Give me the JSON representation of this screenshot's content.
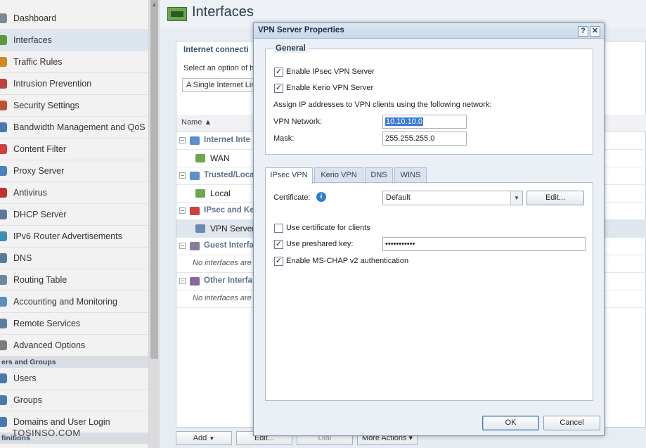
{
  "sidebar": {
    "items": [
      {
        "label": "Dashboard",
        "icon": "dashboard-icon",
        "color": "#7a8a9a"
      },
      {
        "label": "Interfaces",
        "icon": "interfaces-icon",
        "color": "#5a9a3a"
      },
      {
        "label": "Traffic Rules",
        "icon": "traffic-rules-icon",
        "color": "#d08a20"
      },
      {
        "label": "Intrusion Prevention",
        "icon": "intrusion-prevention-icon",
        "color": "#c04040"
      },
      {
        "label": "Security Settings",
        "icon": "security-settings-icon",
        "color": "#c05030"
      },
      {
        "label": "Bandwidth Management and QoS",
        "icon": "bandwidth-icon",
        "color": "#4a7ab0"
      },
      {
        "label": "Content Filter",
        "icon": "content-filter-icon",
        "color": "#d04040"
      },
      {
        "label": "Proxy Server",
        "icon": "proxy-server-icon",
        "color": "#4a80c0"
      },
      {
        "label": "Antivirus",
        "icon": "antivirus-icon",
        "color": "#c03030"
      },
      {
        "label": "DHCP Server",
        "icon": "dhcp-server-icon",
        "color": "#5a7a9a"
      },
      {
        "label": "IPv6 Router Advertisements",
        "icon": "ipv6-icon",
        "color": "#3a90b0"
      },
      {
        "label": "DNS",
        "icon": "dns-icon",
        "color": "#5a7a9a"
      },
      {
        "label": "Routing Table",
        "icon": "routing-table-icon",
        "color": "#6a8aa0"
      },
      {
        "label": "Accounting and Monitoring",
        "icon": "accounting-icon",
        "color": "#5a90c0"
      },
      {
        "label": "Remote Services",
        "icon": "remote-services-icon",
        "color": "#5a80a0"
      },
      {
        "label": "Advanced Options",
        "icon": "advanced-options-icon",
        "color": "#7a7a7a"
      }
    ],
    "section_users": "ers and Groups",
    "user_items": [
      {
        "label": "Users",
        "icon": "users-icon",
        "color": "#4a78b0"
      },
      {
        "label": "Groups",
        "icon": "groups-icon",
        "color": "#4a78b0"
      },
      {
        "label": "Domains and User Login",
        "icon": "domains-icon",
        "color": "#4a78b0"
      }
    ],
    "section_definitions": "finitions"
  },
  "main": {
    "page_title": "Interfaces",
    "internet_fieldset_title": "Internet connecti",
    "select_option_label": "Select an option of h",
    "connectivity_value": "A Single Internet Lir",
    "grid": {
      "col_name": "Name ▲",
      "rows": [
        {
          "type": "group",
          "label": "Internet Inte",
          "icon": "cloud-icon",
          "color": "#5a90d0"
        },
        {
          "type": "item",
          "label": "WAN",
          "icon": "nic-icon",
          "color": "#6aa84f"
        },
        {
          "type": "group",
          "label": "Trusted/Loca",
          "icon": "cloud-icon",
          "color": "#5a90d0"
        },
        {
          "type": "item",
          "label": "Local",
          "icon": "nic-icon",
          "color": "#6aa84f"
        },
        {
          "type": "group",
          "label": "IPsec and Ke",
          "icon": "shield-icon",
          "color": "#d04040"
        },
        {
          "type": "item",
          "label": "VPN Server",
          "icon": "vpn-server-icon",
          "color": "#6a8ab0",
          "selected": true
        },
        {
          "type": "group",
          "label": "Guest Interfa",
          "icon": "guest-icon",
          "color": "#8a7aa0"
        },
        {
          "type": "note",
          "label": "No interfaces are"
        },
        {
          "type": "group",
          "label": "Other Interfa",
          "icon": "other-icon",
          "color": "#8a6a9a"
        },
        {
          "type": "note",
          "label": "No interfaces are"
        }
      ]
    },
    "toolbar": {
      "add_label": "Add",
      "edit_label": "Edit...",
      "dial_label": "Dial",
      "more_label": "More Actions ▾"
    }
  },
  "dialog": {
    "title": "VPN Server Properties",
    "help_btn": "?",
    "close_btn": "✕",
    "general": {
      "legend": "General",
      "enable_ipsec": "Enable IPsec VPN Server",
      "enable_kerio": "Enable Kerio VPN Server",
      "assign_text": "Assign IP addresses to VPN clients using the following network:",
      "vpn_network_label": "VPN Network:",
      "vpn_network_value": "10.10.10.0",
      "mask_label": "Mask:",
      "mask_value": "255.255.255.0"
    },
    "tabs": [
      "IPsec VPN",
      "Kerio VPN",
      "DNS",
      "WINS"
    ],
    "ipsec": {
      "certificate_label": "Certificate:",
      "certificate_value": "Default",
      "edit_button": "Edit...",
      "use_cert_label": "Use certificate for clients",
      "use_psk_label": "Use preshared key:",
      "psk_value": "•••••••••••",
      "mschap_label": "Enable MS-CHAP v2 authentication"
    },
    "ok_label": "OK",
    "cancel_label": "Cancel"
  },
  "watermark": "TOSINSO.COM"
}
